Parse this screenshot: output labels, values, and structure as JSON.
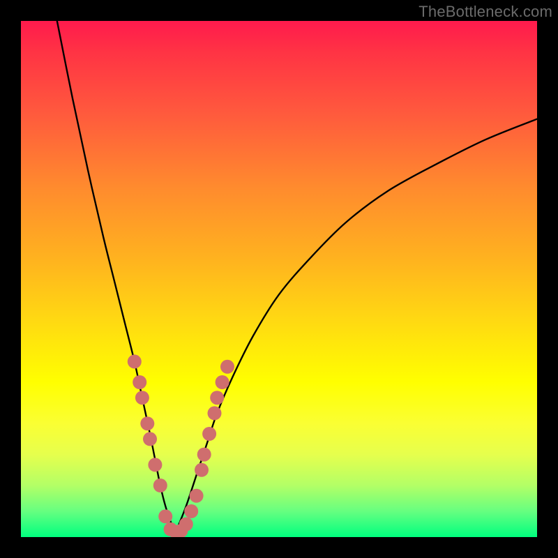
{
  "watermark": "TheBottleneck.com",
  "chart_data": {
    "type": "line",
    "title": "",
    "xlabel": "",
    "ylabel": "",
    "xlim": [
      0,
      100
    ],
    "ylim": [
      0,
      100
    ],
    "series": [
      {
        "name": "left-curve",
        "x": [
          7,
          10,
          13,
          16,
          18,
          20,
          22,
          23.5,
          25,
          26,
          27,
          28,
          29,
          30
        ],
        "y": [
          100,
          85,
          71,
          58,
          50,
          42,
          34,
          27,
          20,
          15,
          10,
          6,
          3,
          1
        ]
      },
      {
        "name": "right-curve",
        "x": [
          30,
          32,
          34,
          36,
          38,
          41,
          45,
          50,
          56,
          63,
          71,
          80,
          90,
          100
        ],
        "y": [
          1,
          6,
          12,
          18,
          24,
          31,
          39,
          47,
          54,
          61,
          67,
          72,
          77,
          81
        ]
      }
    ],
    "trough_x": 30,
    "markers": {
      "left": [
        {
          "x": 22,
          "y": 34
        },
        {
          "x": 23,
          "y": 30
        },
        {
          "x": 23.5,
          "y": 27
        },
        {
          "x": 24.5,
          "y": 22
        },
        {
          "x": 25,
          "y": 19
        },
        {
          "x": 26,
          "y": 14
        },
        {
          "x": 27,
          "y": 10
        }
      ],
      "bottom": [
        {
          "x": 28,
          "y": 4
        },
        {
          "x": 29,
          "y": 1.5
        },
        {
          "x": 30,
          "y": 1
        },
        {
          "x": 31,
          "y": 1.2
        },
        {
          "x": 32,
          "y": 2.5
        },
        {
          "x": 33,
          "y": 5
        },
        {
          "x": 34,
          "y": 8
        }
      ],
      "right": [
        {
          "x": 35,
          "y": 13
        },
        {
          "x": 35.5,
          "y": 16
        },
        {
          "x": 36.5,
          "y": 20
        },
        {
          "x": 37.5,
          "y": 24
        },
        {
          "x": 38,
          "y": 27
        },
        {
          "x": 39,
          "y": 30
        },
        {
          "x": 40,
          "y": 33
        }
      ]
    },
    "colors": {
      "curve": "#000000",
      "marker": "#cf6e6e"
    }
  }
}
